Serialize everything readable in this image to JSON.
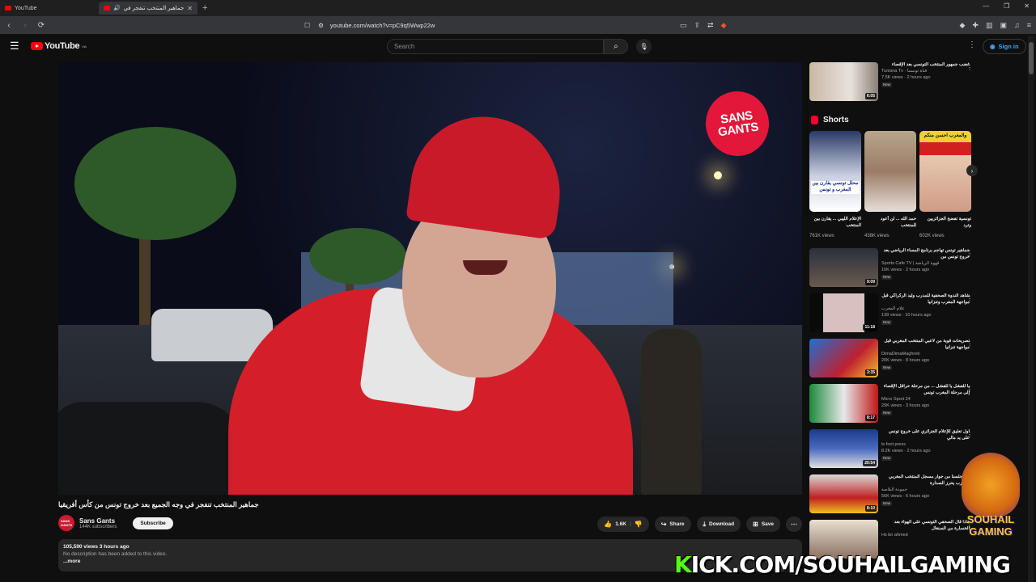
{
  "browser": {
    "tabs": [
      {
        "label": "YouTube"
      },
      {
        "label": "جماهير المنتخب تنفجر في وجه"
      }
    ],
    "url": "youtube.com/watch?v=pC9q5Wwp22w"
  },
  "header": {
    "logo": "YouTube",
    "region": "MA",
    "search_placeholder": "Search",
    "sign_in": "Sign in"
  },
  "video": {
    "badge_line1": "SANS",
    "badge_line2": "GANTS",
    "title": "جماهير المنتخب تنفجر في وجه الجميع بعد خروج تونس من كأس أفريقيا",
    "channel": "Sans Gants",
    "subscribers": "144K subscribers",
    "subscribe": "Subscribe",
    "likes": "1.6K",
    "share": "Share",
    "download": "Download",
    "save": "Save",
    "views_meta": "105,590 views  3 hours ago",
    "description": "No description has been added to this video.",
    "more": "...more"
  },
  "sidebar": {
    "top_video": {
      "title": "غضب جمهور المنتخب التونسي بعد الإقصاء",
      "channel": "Tunisna Tv · قناة تونسنا",
      "views": "7.5K views · 2 hours ago",
      "duration": "6:05",
      "badge": "New"
    },
    "shorts_label": "Shorts",
    "shorts": [
      {
        "title": "الإعلام الليبي ... يقارن بين المنتخب",
        "views": "761K views",
        "overlay": "محلل تونسي يقارن بين المغرب و تونس"
      },
      {
        "title": "حمد الله ... لن أعود للمنتخب",
        "views": "438K views",
        "overlay": ""
      },
      {
        "title": "تونسية تفضح الجزائريين وترد",
        "views": "602K views",
        "overlay": "والمغرب احسن منكم"
      }
    ],
    "videos": [
      {
        "title": "جماهير تونس تهاجم برنامج المساء الرياضي بعد خروج تونس من",
        "channel": "Sports Cafe TV | قهوة الرياضة",
        "views": "16K views · 2 hours ago",
        "duration": "9:09",
        "badge": "New"
      },
      {
        "title": "شاهد الندوة الصحفية للمدرب وليد الركراكي قبل مواجهة المغرب وتنزانيا",
        "channel": "علام المغرب",
        "views": "138 views · 10 hours ago",
        "duration": "11:18",
        "badge": "New"
      },
      {
        "title": "تصريحات قوية من لاعبي المنتخب المغربي قبل مواجهة تنزانيا",
        "channel": "DimaDimaMaghreb",
        "views": "20K views · 8 hours ago",
        "duration": "3:35",
        "badge": "New"
      },
      {
        "title": "يا للفشل يا للفشل ... من مرحلة حراقل الإقصاء إلى مرحلة المغرب تونس",
        "channel": "Micro Sport 24",
        "views": "29K views · 3 hours ago",
        "duration": "8:17",
        "badge": "New"
      },
      {
        "title": "أول تعليق للإعلام الجزائري على خروج تونس على يد مالي",
        "channel": "le foot press",
        "views": "8.2K views · 2 hours ago",
        "duration": "20:54",
        "badge": "New"
      },
      {
        "title": "لقد جلسنا من جوار مسجل المنتخب المغربي المغرب يحرز الصدارة",
        "channel": "حمودة البلاصة",
        "views": "56K views · 6 hours ago",
        "duration": "8:10",
        "badge": "New"
      },
      {
        "title": "ماذا قال الصحفي التونسي على الهواء بعد الخسارة من السنغال",
        "channel": "Hs bn ahmed",
        "views": "",
        "duration": "",
        "badge": ""
      }
    ]
  },
  "overlays": {
    "kick_k": "K",
    "kick_rest": "ICK.COM/SOUHAILGAMING",
    "logo_line1": "SOUHAIL",
    "logo_line2": "GAMING"
  }
}
